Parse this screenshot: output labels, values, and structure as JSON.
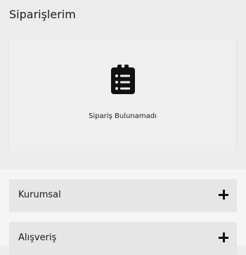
{
  "orders": {
    "title": "Siparişlerim",
    "empty_icon": "clipboard-list-icon",
    "empty_message": "Sipariş Bulunamadı"
  },
  "accordions": [
    {
      "label": "Kurumsal",
      "icon": "plus-icon"
    },
    {
      "label": "Alışveriş",
      "icon": "plus-icon"
    }
  ],
  "colors": {
    "background": "#ededed",
    "card": "#efefef",
    "accordion": "#e6e6e6",
    "text": "#1a1a1a"
  }
}
